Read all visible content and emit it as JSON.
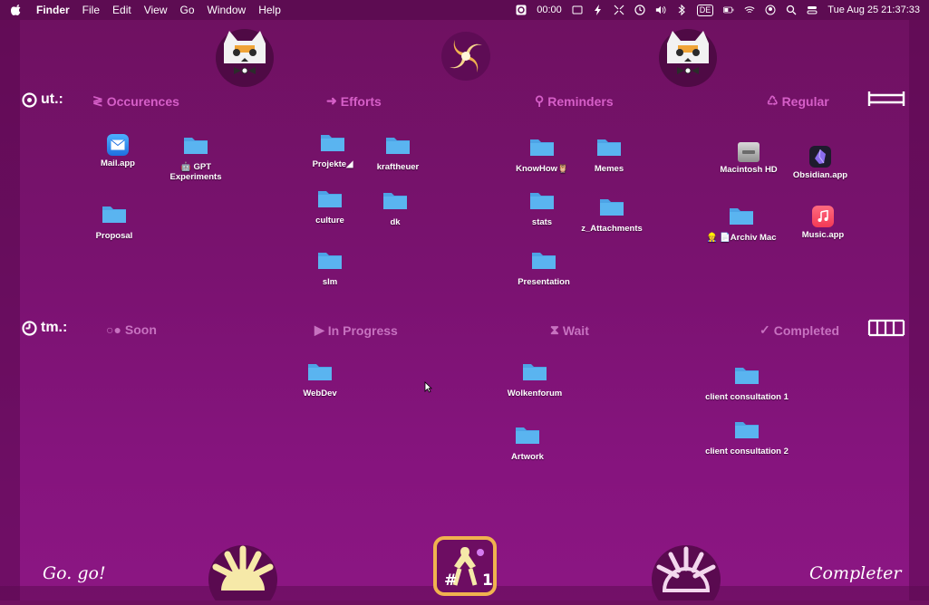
{
  "menubar": {
    "app_name": "Finder",
    "menus": [
      "File",
      "Edit",
      "View",
      "Go",
      "Window",
      "Help"
    ],
    "status": {
      "timer": "00:00",
      "input_source": "DE",
      "datetime": "Tue Aug 25  21:37:33"
    },
    "icons": [
      "apple-icon",
      "timer-app-icon",
      "display-icon",
      "bolt-icon",
      "move-icon",
      "clock-icon",
      "volume-icon",
      "bluetooth-icon",
      "battery-icon",
      "wifi-icon",
      "user-icon",
      "search-icon",
      "control-center-icon"
    ]
  },
  "rows": {
    "ut": {
      "label": "ut.:",
      "columns": [
        {
          "icon": "≷",
          "label": "Occurences"
        },
        {
          "icon": "➜",
          "label": "Efforts"
        },
        {
          "icon": "⚲",
          "label": "Reminders"
        },
        {
          "icon": "♺",
          "label": "Regular"
        }
      ]
    },
    "tm": {
      "label": "tm.:",
      "columns": [
        {
          "icon": "○●",
          "label": "Soon"
        },
        {
          "icon": "▶",
          "label": "In Progress"
        },
        {
          "icon": "⧗",
          "label": "Wait"
        },
        {
          "icon": "✓",
          "label": "Completed"
        }
      ]
    }
  },
  "desktop_items": [
    {
      "label": "Mail.app",
      "type": "app-mail"
    },
    {
      "label": "🤖 GPT Experiments",
      "type": "folder"
    },
    {
      "label": "Proposal",
      "type": "folder"
    },
    {
      "label": "Projekte◢",
      "type": "folder"
    },
    {
      "label": "kraftheuer",
      "type": "folder"
    },
    {
      "label": "culture",
      "type": "folder"
    },
    {
      "label": "dk",
      "type": "folder"
    },
    {
      "label": "slm",
      "type": "folder"
    },
    {
      "label": "KnowHow🦉",
      "type": "folder"
    },
    {
      "label": "Memes",
      "type": "folder"
    },
    {
      "label": "stats",
      "type": "folder"
    },
    {
      "label": "z_Attachments",
      "type": "folder"
    },
    {
      "label": "Presentation",
      "type": "folder"
    },
    {
      "label": "Macintosh HD",
      "type": "drive"
    },
    {
      "label": "Obsidian.app",
      "type": "app-obsidian"
    },
    {
      "label": "👷 📄Archiv Mac",
      "type": "folder"
    },
    {
      "label": "Music.app",
      "type": "app-music"
    },
    {
      "label": "WebDev",
      "type": "folder"
    },
    {
      "label": "Wolkenforum",
      "type": "folder"
    },
    {
      "label": "Artwork",
      "type": "folder"
    },
    {
      "label": "client consultation 1",
      "type": "folder"
    },
    {
      "label": "client consultation 2",
      "type": "folder"
    }
  ],
  "bottom": {
    "left_text": "Go. go!",
    "right_text": "Completer",
    "badge_text": "#",
    "badge_number": "1"
  },
  "colors": {
    "background": "#7a1270",
    "folder": "#5ab4f0",
    "header_ut": "#d65fc8",
    "header_tm": "#c772c0"
  }
}
